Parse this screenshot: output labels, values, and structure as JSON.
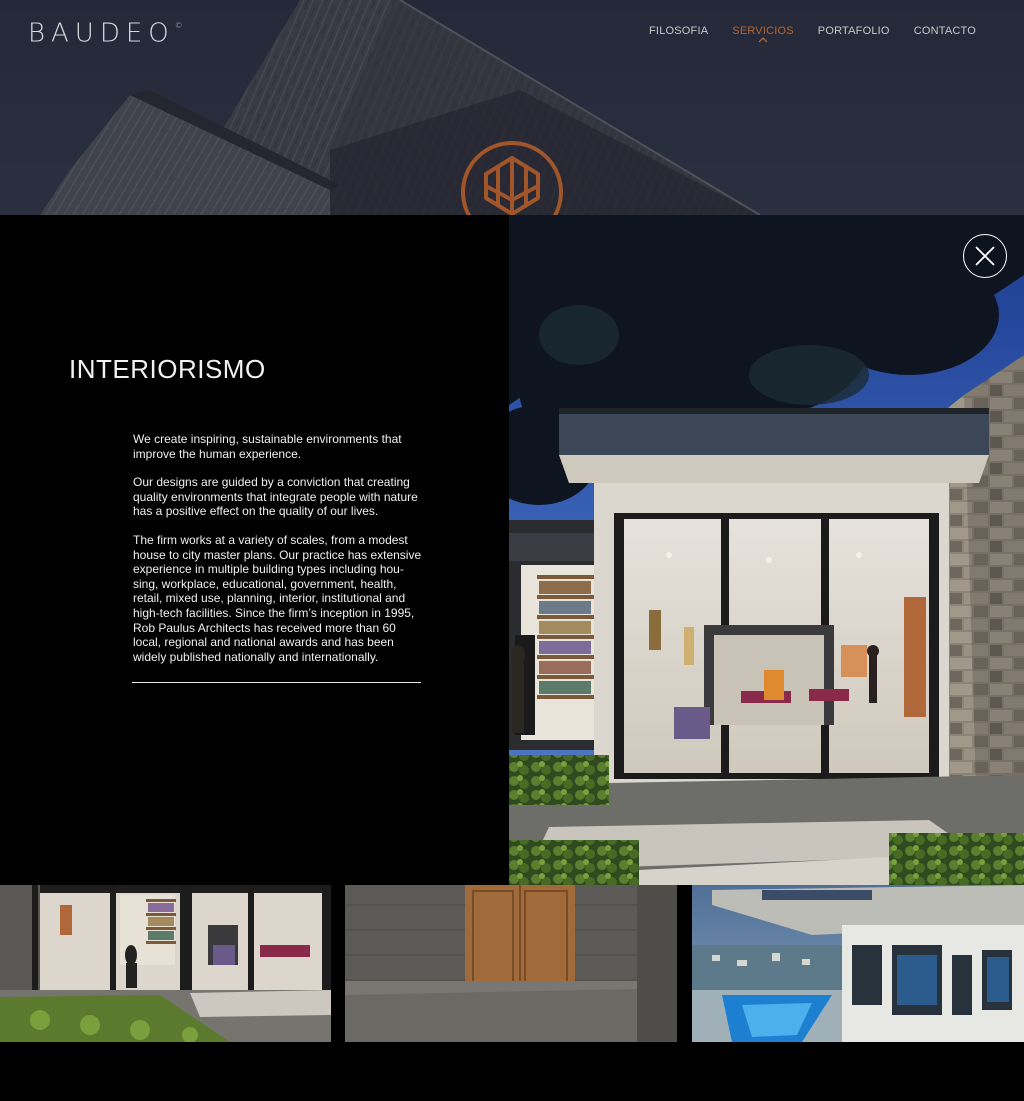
{
  "brand": {
    "logo_text": "BAUDEO",
    "logo_mark": "©"
  },
  "nav": {
    "items": [
      {
        "label": "FILOSOFIA",
        "active": false
      },
      {
        "label": "SERVICIOS",
        "active": true
      },
      {
        "label": "PORTAFOLIO",
        "active": false
      },
      {
        "label": "CONTACTO",
        "active": false
      }
    ]
  },
  "colors": {
    "accent": "#b8652e",
    "background": "#000000",
    "text": "#f0f0f0"
  },
  "modal": {
    "title": "INTERIORISMO",
    "paragraphs": [
      "We create inspiring, sustainable environments that improve the human experience.",
      "Our designs are guided by a conviction that creating quality environments that integrate people with nature has a positive effect on the quality of our lives.",
      "The firm works at a variety of scales, from a modest house to city master plans. Our practice has extensive experience in multiple building types including hou-sing, workplace, educational, government, health, retail, mixed use, planning, interior, institutional and high-tech facilities. Since the firm’s inception in 1995, Rob Paulus Architects has received more than 60 local, regional and national awards and has been widely published nationally and internationally."
    ],
    "close_icon": "close-icon"
  },
  "thumbnails": [
    {
      "name": "interior-gallery-thumb"
    },
    {
      "name": "wood-door-concrete-thumb"
    },
    {
      "name": "pool-house-thumb"
    }
  ]
}
